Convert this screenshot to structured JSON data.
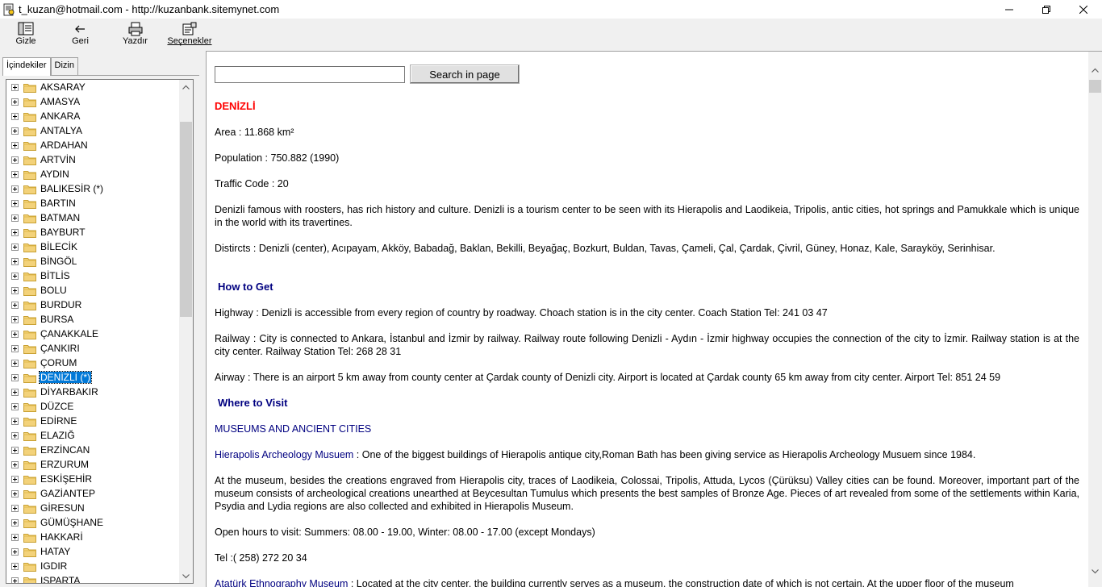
{
  "window": {
    "title": "t_kuzan@hotmail.com - http://kuzanbank.sitemynet.com"
  },
  "toolbar": {
    "buttons": [
      {
        "label": "Gizle",
        "icon": "hide-icon"
      },
      {
        "label": "Geri",
        "icon": "back-icon"
      },
      {
        "label": "Yazdır",
        "icon": "print-icon"
      },
      {
        "label": "Seçenekler",
        "icon": "options-icon"
      }
    ]
  },
  "sidebar": {
    "tabs": [
      {
        "label": "İçindekiler",
        "active": true
      },
      {
        "label": "Dizin",
        "active": false
      }
    ],
    "items": [
      "AKSARAY",
      "AMASYA",
      "ANKARA",
      "ANTALYA",
      "ARDAHAN",
      "ARTVİN",
      "AYDIN",
      "BALIKESİR (*)",
      "BARTIN",
      "BATMAN",
      "BAYBURT",
      "BİLECİK",
      "BİNGÖL",
      "BİTLİS",
      "BOLU",
      "BURDUR",
      "BURSA",
      "ÇANAKKALE",
      "ÇANKIRI",
      "ÇORUM",
      "DENİZLİ (*)",
      "DİYARBAKIR",
      "DÜZCE",
      "EDİRNE",
      "ELAZIĞ",
      "ERZİNCAN",
      "ERZURUM",
      "ESKİŞEHİR",
      "GAZİANTEP",
      "GİRESUN",
      "GÜMÜŞHANE",
      "HAKKARİ",
      "HATAY",
      "IGDIR",
      "ISPARTA"
    ],
    "selected": "DENİZLİ (*)"
  },
  "search": {
    "placeholder": "",
    "button_label": "Search in page"
  },
  "article": {
    "title": "DENİZLİ",
    "area": "Area : 11.868 km²",
    "population": "Population : 750.882 (1990)",
    "traffic": "Traffic Code : 20",
    "intro": "Denizli famous with roosters, has rich history and culture. Denizli is a tourism center to be seen with its Hierapolis and Laodikeia, Tripolis, antic cities, hot springs and Pamukkale which is unique in the world with its travertines.",
    "districts": "Distircts : Denizli (center), Acıpayam, Akköy, Babadağ, Baklan, Bekilli, Beyağaç, Bozkurt, Buldan, Tavas, Çameli, Çal, Çardak, Çivril, Güney, Honaz, Kale, Sarayköy, Serinhisar.",
    "how_to_get": "How to Get",
    "highway": "Highway : Denizli is accessible from every region of country by roadway. Choach station is in the city center. Coach Station Tel: 241 03 47",
    "railway": "Railway : City is connected to Ankara, İstanbul and İzmir by railway. Railway route following Denizli - Aydın - İzmir highway occupies the connection of the city to İzmir. Railway station is at the city center. Railway Station Tel: 268 28 31",
    "airway": "Airway : There is an airport 5 km away from county center at Çardak county of Denizli city. Airport is located at Çardak county 65 km away from city center. Airport Tel: 851 24 59",
    "where_to_visit": "Where to Visit",
    "museums_heading": "MUSEUMS AND ANCIENT CITIES",
    "museum1_name": "Hierapolis Archeology Musuem",
    "museum1_text": " : One of the biggest buildings of Hierapolis antique city,Roman Bath has been giving service as Hierapolis Archeology Musuem since 1984.",
    "museum1_detail": "At the museum, besides the creations engraved from Hierapolis city, traces of Laodikeia, Colossai, Tripolis, Attuda, Lycos (Çürüksu) Valley cities can be found. Moreover, important part of the museum consists of archeological creations unearthed at Beycesultan Tumulus which presents the best samples of Bronze Age. Pieces of art revealed from some of the settlements within Karia, Psydia and Lydia regions are also collected and exhibited in Hierapolis Museum.",
    "hours": "Open hours to visit: Summers: 08.00 - 19.00, Winter: 08.00 - 17.00 (except Mondays)",
    "tel": "Tel :( 258) 272 20 34",
    "museum2_name": "Atatürk Ethnography Museum",
    "museum2_text": " : Located at the city center, the building currently serves as a museum, the construction date of which is not certain. At the upper floor of the museum"
  }
}
